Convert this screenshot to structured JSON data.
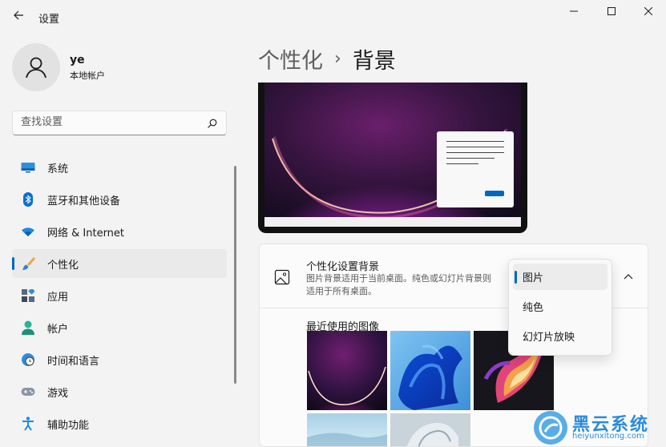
{
  "window": {
    "title": "设置"
  },
  "profile": {
    "name": "ye",
    "account_type": "本地帐户"
  },
  "search": {
    "placeholder": "查找设置"
  },
  "sidebar": {
    "items": [
      {
        "label": "系统",
        "icon": "system-icon"
      },
      {
        "label": "蓝牙和其他设备",
        "icon": "bluetooth-icon"
      },
      {
        "label": "网络 & Internet",
        "icon": "wifi-icon"
      },
      {
        "label": "个性化",
        "icon": "brush-icon",
        "active": true
      },
      {
        "label": "应用",
        "icon": "apps-icon"
      },
      {
        "label": "帐户",
        "icon": "person-icon"
      },
      {
        "label": "时间和语言",
        "icon": "clock-globe-icon"
      },
      {
        "label": "游戏",
        "icon": "gamepad-icon"
      },
      {
        "label": "辅助功能",
        "icon": "accessibility-icon"
      }
    ]
  },
  "breadcrumb": {
    "parent": "个性化",
    "separator": "›",
    "current": "背景"
  },
  "background_setting": {
    "title": "个性化设置背景",
    "description": "图片背景适用于当前桌面。纯色或幻灯片背景则适用于所有桌面。",
    "recent_images_label": "最近使用的图像"
  },
  "dropdown": {
    "options": [
      "图片",
      "纯色",
      "幻灯片放映"
    ],
    "selected": "图片"
  },
  "watermark": {
    "title": "黑云系统",
    "url": "heiyunxitong.com"
  },
  "colors": {
    "accent": "#0067c0",
    "background": "#f3f3f3"
  }
}
